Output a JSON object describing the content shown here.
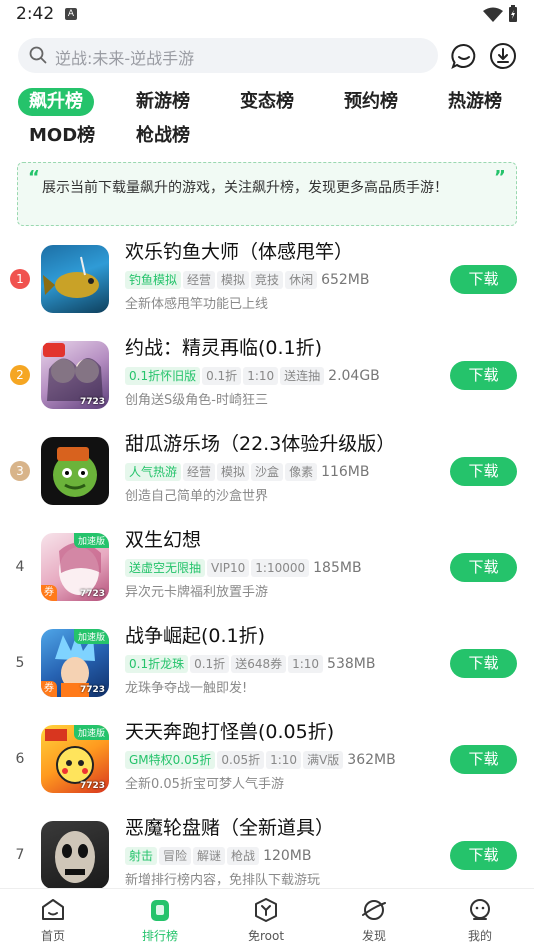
{
  "status": {
    "time": "2:42",
    "a_badge": "A"
  },
  "search": {
    "placeholder": "逆战:未来-逆战手游"
  },
  "tabs": [
    {
      "label": "飙升榜",
      "active": true
    },
    {
      "label": "新游榜"
    },
    {
      "label": "变态榜"
    },
    {
      "label": "预约榜"
    },
    {
      "label": "热游榜"
    },
    {
      "label": "MOD榜"
    },
    {
      "label": "枪战榜"
    }
  ],
  "notice": {
    "text": "展示当前下载量飙升的游戏，关注飙升榜，发现更多高品质手游！",
    "quote_open": "“",
    "quote_close": "”"
  },
  "colors": {
    "accent": "#25c36b",
    "rank1": "#f0524f",
    "rank2": "#f5a623",
    "rank3": "#d8b48a"
  },
  "games": [
    {
      "rank": "1",
      "title": "欢乐钓鱼大师（体感甩竿）",
      "tags": [
        "钓鱼模拟",
        "经营",
        "模拟",
        "竞技",
        "休闲"
      ],
      "size": "652MB",
      "desc": "全新体感甩竿功能已上线",
      "download": "下载"
    },
    {
      "rank": "2",
      "title": "约战：精灵再临(0.1折)",
      "tags": [
        "0.1折怀旧版",
        "0.1折",
        "1:10",
        "送连抽"
      ],
      "size": "2.04GB",
      "desc": "创角送S级角色-时崎狂三",
      "download": "下载",
      "badge_7723": "7723"
    },
    {
      "rank": "3",
      "title": "甜瓜游乐场（22.3体验升级版）",
      "tags": [
        "人气热游",
        "经营",
        "模拟",
        "沙盒",
        "像素"
      ],
      "size": "116MB",
      "desc": "创造自己简单的沙盒世界",
      "download": "下载"
    },
    {
      "rank": "4",
      "title": "双生幻想",
      "tags": [
        "送虚空无限抽",
        "VIP10",
        "1:10000"
      ],
      "size": "185MB",
      "desc": "异次元卡牌福利放置手游",
      "download": "下载",
      "badge": "加速版",
      "badge_7723": "7723",
      "coupon": "券"
    },
    {
      "rank": "5",
      "title": "战争崛起(0.1折)",
      "tags": [
        "0.1折龙珠",
        "0.1折",
        "送648券",
        "1:10"
      ],
      "size": "538MB",
      "desc": "龙珠争夺战一触即发!",
      "download": "下载",
      "badge": "加速版",
      "badge_7723": "7723",
      "coupon": "券"
    },
    {
      "rank": "6",
      "title": "天天奔跑打怪兽(0.05折)",
      "tags": [
        "GM特权0.05折",
        "0.05折",
        "1:10",
        "满V版"
      ],
      "size": "362MB",
      "desc": "全新0.05折宝可梦人气手游",
      "download": "下载",
      "badge": "加速版",
      "badge_7723": "7723"
    },
    {
      "rank": "7",
      "title": "恶魔轮盘赌（全新道具）",
      "tags": [
        "射击",
        "冒险",
        "解谜",
        "枪战"
      ],
      "size": "120MB",
      "desc": "新增排行榜内容，免排队下载游玩",
      "download": "下载"
    }
  ],
  "nav": [
    {
      "label": "首页",
      "icon": "home-icon"
    },
    {
      "label": "排行榜",
      "icon": "rank-icon",
      "active": true
    },
    {
      "label": "免root",
      "icon": "shield-y-icon"
    },
    {
      "label": "发现",
      "icon": "planet-icon"
    },
    {
      "label": "我的",
      "icon": "profile-icon"
    }
  ]
}
